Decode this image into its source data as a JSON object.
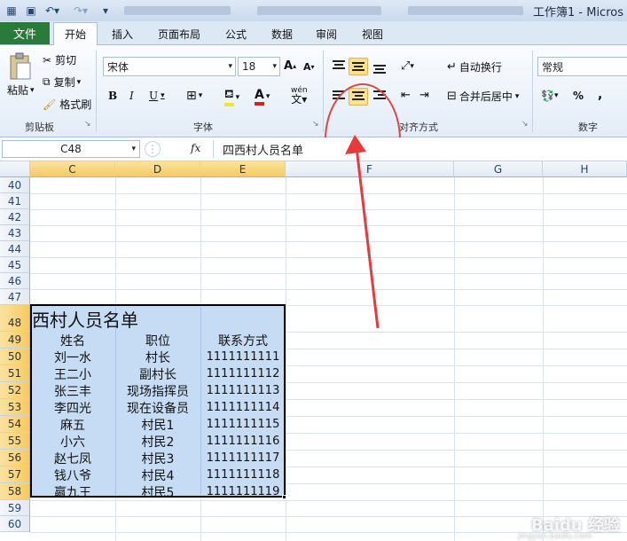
{
  "window": {
    "title": "工作簿1 - Micros"
  },
  "tabs": {
    "file": "文件",
    "items": [
      "开始",
      "插入",
      "页面布局",
      "公式",
      "数据",
      "审阅",
      "视图"
    ]
  },
  "clipboard": {
    "paste": "粘贴",
    "cut": "剪切",
    "copy": "复制",
    "format_painter": "格式刷",
    "label": "剪贴板"
  },
  "font": {
    "name": "宋体",
    "size": "18",
    "bold": "B",
    "italic": "I",
    "underline": "U",
    "label": "字体",
    "wen": "wén"
  },
  "alignment": {
    "wrap_text": "自动换行",
    "merge_center": "合并后居中",
    "label": "对齐方式"
  },
  "number": {
    "format": "常规",
    "percent": "%",
    "comma": ",",
    "label": "数字"
  },
  "formula_bar": {
    "name_box": "C48",
    "fx": "fx",
    "content": "四西村人员名单"
  },
  "columns": [
    "C",
    "D",
    "E",
    "F",
    "G",
    "H"
  ],
  "rows": [
    "40",
    "41",
    "42",
    "43",
    "44",
    "45",
    "46",
    "47",
    "48",
    "49",
    "50",
    "51",
    "52",
    "53",
    "54",
    "55",
    "56",
    "57",
    "58",
    "59",
    "60"
  ],
  "table": {
    "title": "西村人员名单",
    "headers": [
      "姓名",
      "职位",
      "联系方式"
    ],
    "data": [
      [
        "刘一水",
        "村长",
        "1111111111"
      ],
      [
        "王二小",
        "副村长",
        "1111111112"
      ],
      [
        "张三丰",
        "现场指挥员",
        "1111111113"
      ],
      [
        "李四光",
        "现在设备员",
        "1111111114"
      ],
      [
        "麻五",
        "村民1",
        "1111111115"
      ],
      [
        "小六",
        "村民2",
        "1111111116"
      ],
      [
        "赵七凤",
        "村民3",
        "1111111117"
      ],
      [
        "钱八爷",
        "村民4",
        "1111111118"
      ],
      [
        "嬴九王",
        "村民5",
        "1111111119"
      ]
    ]
  },
  "colors": {
    "file_tab": "#2a7a3a",
    "selection": "#c6dcf5",
    "highlight": "#ffe289",
    "annotation": "#e04444"
  },
  "watermark": {
    "brand": "Baidu 经验",
    "site": "jingyan.baidu.com"
  }
}
